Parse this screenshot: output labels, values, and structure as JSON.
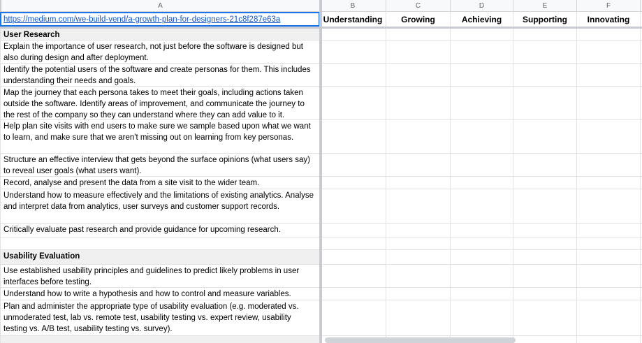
{
  "column_headers": [
    "A",
    "B",
    "C",
    "D",
    "E",
    "F"
  ],
  "frozen_row": {
    "url": "https://medium.com/we-build-vend/a-growth-plan-for-designers-21c8f287e63a",
    "levels": [
      "Understanding",
      "Growing",
      "Achieving",
      "Supporting",
      "Innovating"
    ]
  },
  "rows": [
    {
      "text": "User Research",
      "type": "section"
    },
    {
      "text": "Explain the importance of user research, not just before the software is designed but also during design and after deployment.",
      "type": "normal"
    },
    {
      "text": "Identify the potential users of the software and create personas for them. This includes understanding their needs and goals.",
      "type": "normal"
    },
    {
      "text": "Map the journey that each persona takes to meet their goals, including actions taken outside the software. Identify areas of improvement, and communicate the journey to the rest of the company so they can understand where they can add value to it.",
      "type": "normal"
    },
    {
      "text": "Help plan site visits with end users to make sure we sample based upon what we want to learn, and make sure that we aren't missing out on learning from key personas.",
      "type": "normal"
    },
    {
      "text": "Structure an effective interview that gets beyond the surface opinions (what users say) to reveal user goals (what users want).",
      "type": "normal"
    },
    {
      "text": "Record, analyse and present the data from a site visit to the wider team.",
      "type": "normal"
    },
    {
      "text": "Understand how to measure effectively and the limitations of existing analytics. Analyse and interpret data from analytics, user surveys and customer support records.",
      "type": "normal"
    },
    {
      "text": "Critically evaluate past research and provide guidance for upcoming research.",
      "type": "normal"
    },
    {
      "text": "",
      "type": "empty"
    },
    {
      "text": "Usability Evaluation",
      "type": "section"
    },
    {
      "text": "Use established usability principles and guidelines to predict likely problems in user interfaces before testing.",
      "type": "normal"
    },
    {
      "text": "Understand how to write a hypothesis and how to control and measure variables.",
      "type": "normal"
    },
    {
      "text": "Plan and administer the appropriate type of usability evaluation (e.g. moderated vs. unmoderated test, lab vs. remote test, usability testing vs. expert review, usability testing vs. A/B test, usability testing vs. survey).",
      "type": "normal"
    },
    {
      "text": "",
      "type": "section"
    }
  ],
  "colors": {
    "selection_border": "#1a73e8",
    "link": "#1155cc",
    "gridline": "#e2e2e2",
    "header_bg": "#f8f9fa",
    "header_text": "#5f6368",
    "section_fill": "#f0f0f0",
    "frozen_divider": "#c8ccd2",
    "scrollbar_thumb": "#d0d3d7"
  }
}
